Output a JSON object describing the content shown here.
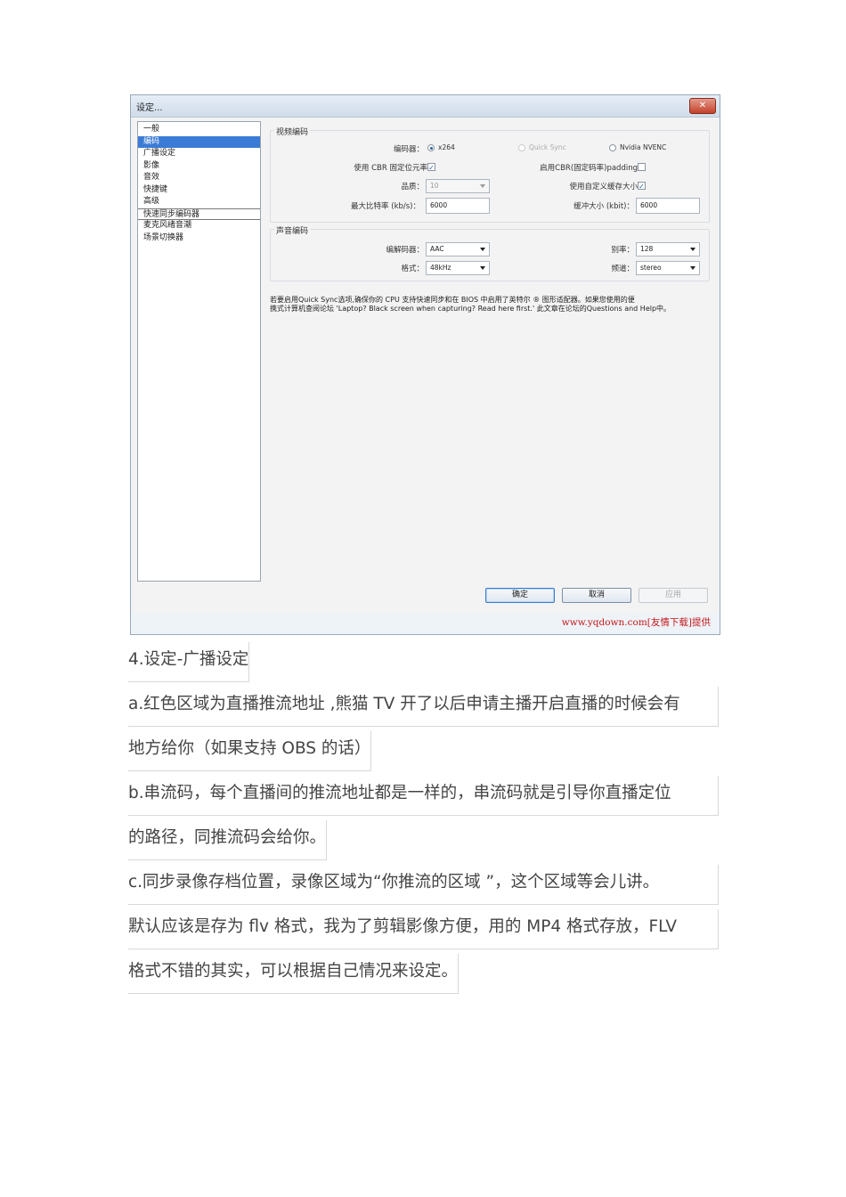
{
  "dialog": {
    "title": "设定...",
    "close_glyph": "✕",
    "sidebar": {
      "items": [
        {
          "label": "一般"
        },
        {
          "label": "编码"
        },
        {
          "label": "广播设定"
        },
        {
          "label": "影像"
        },
        {
          "label": "音效"
        },
        {
          "label": "快捷键"
        },
        {
          "label": "高级"
        },
        {
          "label": "快速同步编码器"
        },
        {
          "label": "麦克风绪音潮"
        },
        {
          "label": "场景切换器"
        }
      ],
      "selected_index": 1
    },
    "video_encoding": {
      "group_title": "视频编码",
      "encoder_label": "编码器：",
      "encoder_options": [
        "x264",
        "Quick Sync",
        "Nvidia NVENC"
      ],
      "encoder_selected": "x264",
      "cbr_label": "使用 CBR 固定位元率",
      "cbr_checked": true,
      "cbr_padding_label": "启用CBR(固定码率)padding",
      "cbr_padding_checked": false,
      "quality_label": "品质：",
      "quality_value": "10",
      "custom_buffer_label": "使用自定义缓存大小",
      "custom_buffer_checked": true,
      "max_bitrate_label": "最大比特率 (kb/s)：",
      "max_bitrate_value": "6000",
      "buffer_size_label": "缓冲大小 (kbit)：",
      "buffer_size_value": "6000"
    },
    "audio_encoding": {
      "group_title": "声音编码",
      "codec_label": "编解码器：",
      "codec_value": "AAC",
      "bitrate_label": "别率：",
      "bitrate_value": "128",
      "format_label": "格式：",
      "format_value": "48kHz",
      "channel_label": "频道：",
      "channel_value": "stereo"
    },
    "note_line1": "若要启用Quick Sync选项,确保你的 CPU 支持快速同步和在 BIOS 中启用了英特尔 ® 图形适配器。如果您使用的便",
    "note_line2": "携式计算机查阅论坛 'Laptop? Black screen when capturing? Read here first.' 此文章在论坛的Questions and Help中。",
    "buttons": {
      "ok": "确定",
      "cancel": "取消",
      "apply": "应用"
    },
    "watermark": "www.yqdown.com[友情下载]提供"
  },
  "article": {
    "heading": "4.设定-广播设定",
    "para_a_line1": "a.红色区域为直播推流地址 ,熊猫 TV 开了以后申请主播开启直播的时候会有",
    "para_a_line2": "地方给你（如果支持 OBS 的话）",
    "para_b_line1": "b.串流码，每个直播间的推流地址都是一样的，串流码就是引导你直播定位",
    "para_b_line2": "的路径，同推流码会给你。",
    "para_c_line1": "c.同步录像存档位置，录像区域为“你推流的区域 ”，这个区域等会儿讲。",
    "para_c_line2": "默认应该是存为 flv 格式，我为了剪辑影像方便，用的 MP4 格式存放，FLV",
    "para_c_line3": "格式不错的其实，可以根据自己情况来设定。"
  }
}
